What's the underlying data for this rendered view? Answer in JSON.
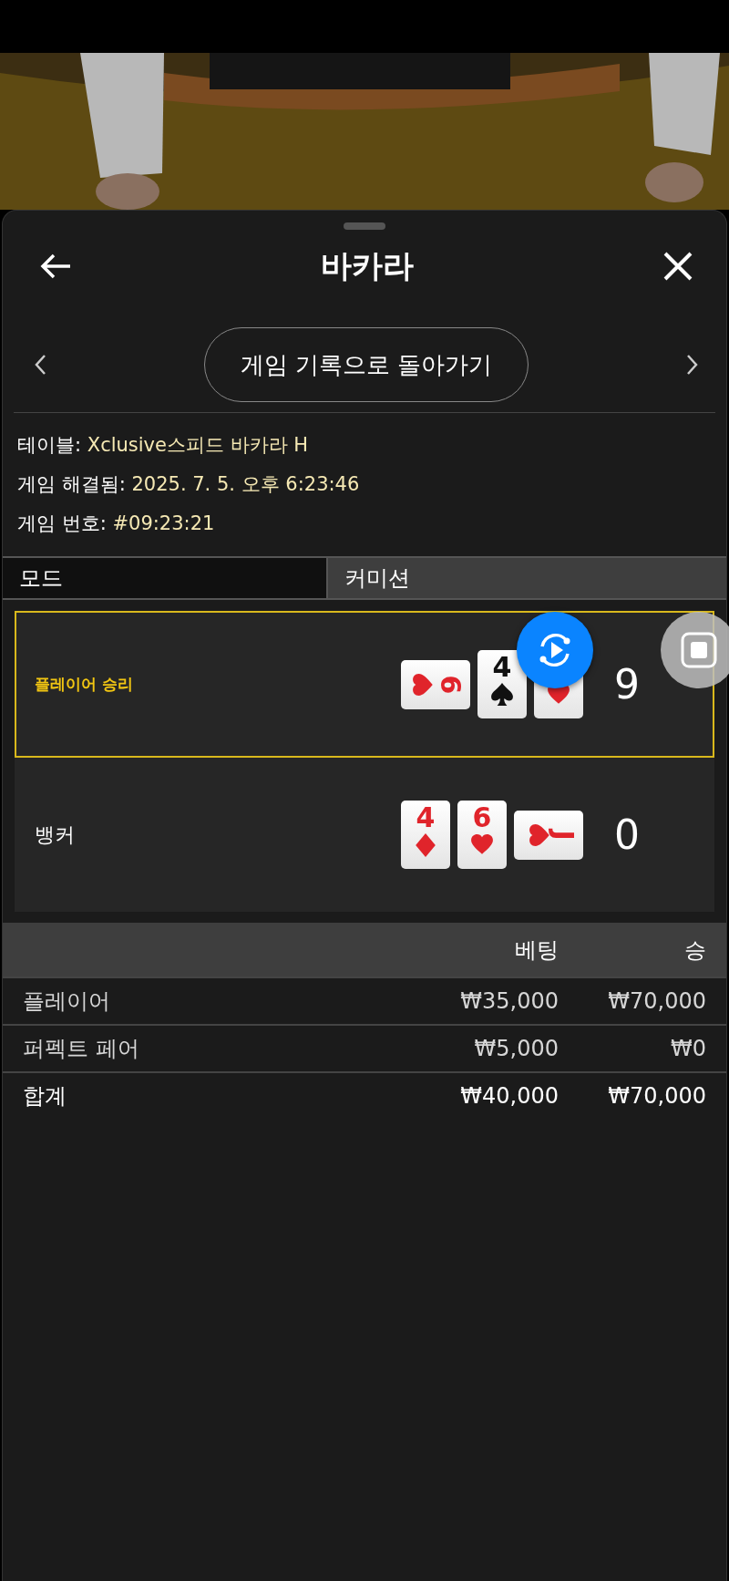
{
  "header": {
    "title": "바카라"
  },
  "nav": {
    "center_label": "게임 기록으로 돌아가기"
  },
  "info": [
    {
      "label": "테이블:",
      "value": "Xclusive스피드 바카라 H"
    },
    {
      "label": "게임 해결됨:",
      "value": "2025. 7. 5. 오후 6:23:46"
    },
    {
      "label": "게임 번호:",
      "value": "#09:23:21"
    }
  ],
  "tabs": [
    {
      "label": "모드",
      "selected": true
    },
    {
      "label": "커미션",
      "selected": false
    }
  ],
  "hands": [
    {
      "label": "플레이어 승리",
      "winner": true,
      "score": "9",
      "cards": [
        {
          "rank": "6",
          "kind": "hearts",
          "sideways": true
        },
        {
          "rank": "4",
          "kind": "spades",
          "sideways": false
        },
        {
          "kind": "hearts",
          "sideways": false
        }
      ]
    },
    {
      "label": "뱅커",
      "winner": false,
      "score": "0",
      "cards": [
        {
          "rank": "4",
          "kind": "diamonds",
          "sideways": false
        },
        {
          "rank": "6",
          "kind": "hearts",
          "sideways": false
        },
        {
          "rank": "J",
          "kind": "hearts",
          "sideways": true
        }
      ]
    }
  ],
  "bets": {
    "columns": [
      "베팅",
      "승"
    ],
    "rows": [
      {
        "kind": "item",
        "name": "플레이어",
        "bet": "₩35,000",
        "win": "₩70,000"
      },
      {
        "kind": "item",
        "name": "퍼펙트 페어",
        "bet": "₩5,000",
        "win": "₩0"
      },
      {
        "kind": "total",
        "name": "합계",
        "bet": "₩40,000",
        "win": "₩70,000"
      }
    ]
  }
}
